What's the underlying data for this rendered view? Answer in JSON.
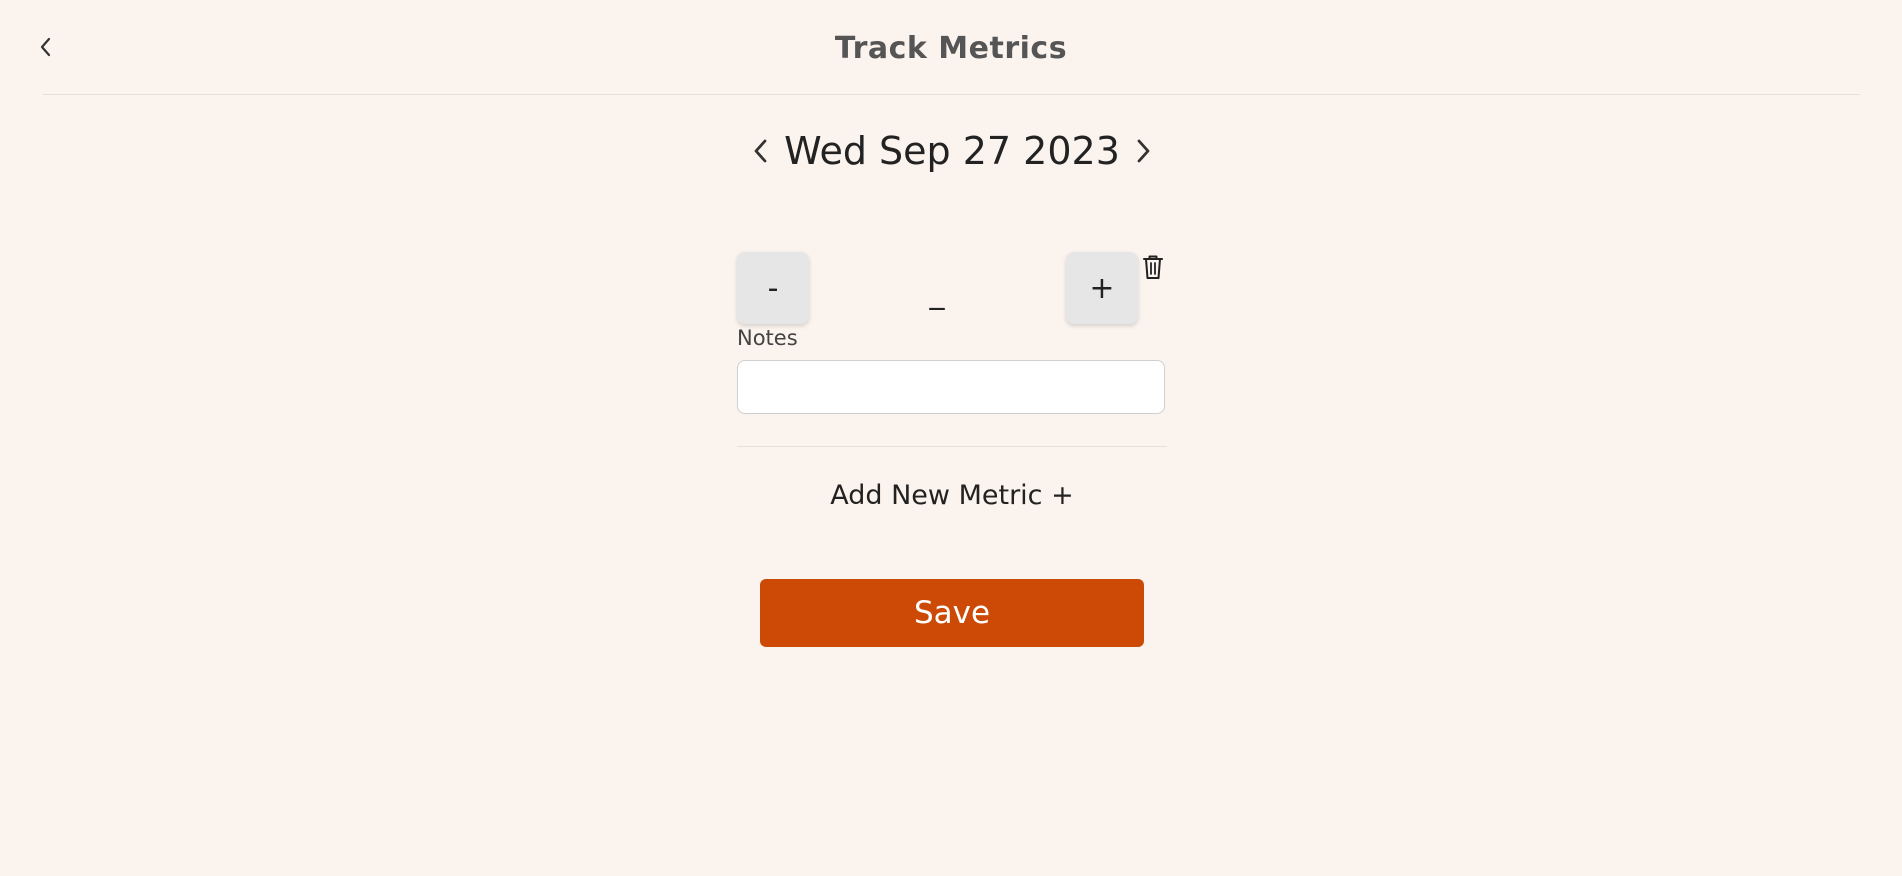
{
  "header": {
    "title": "Track Metrics",
    "back_icon": "chevron-left-icon"
  },
  "date_nav": {
    "date_label": "Wed Sep 27 2023",
    "prev_icon": "chevron-left-icon",
    "next_icon": "chevron-right-icon"
  },
  "metric": {
    "decrement_label": "-",
    "increment_label": "+",
    "value": "_",
    "delete_icon": "trash-icon",
    "notes_label": "Notes",
    "notes_value": "",
    "notes_placeholder": ""
  },
  "add_metric_label": "Add New Metric +",
  "save_label": "Save",
  "colors": {
    "background": "#fbf3ee",
    "accent": "#cc4a06",
    "stepper": "#e6e6e6"
  }
}
